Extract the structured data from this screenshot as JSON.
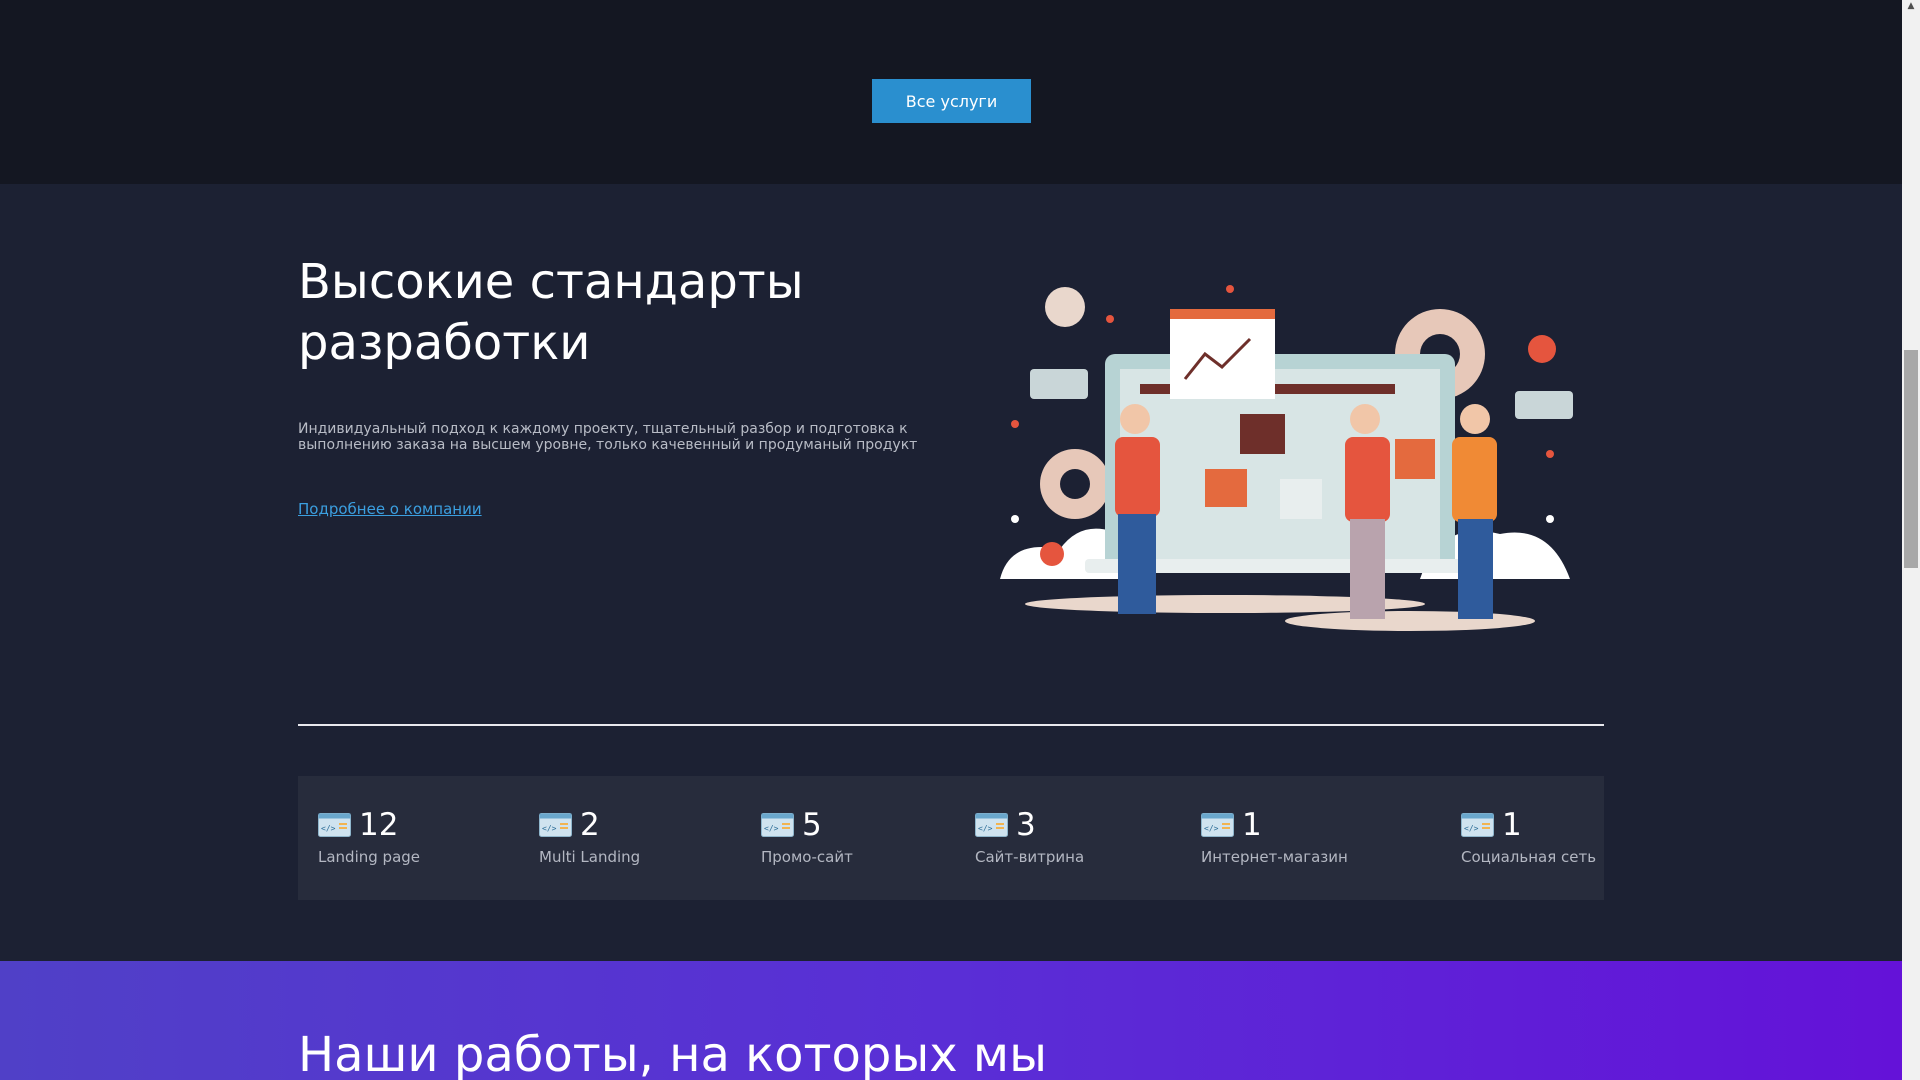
{
  "top": {
    "all_services_label": "Все услуги"
  },
  "standards": {
    "title_line1": "Высокие стандарты",
    "title_line2": "разработки",
    "description": "Индивидуальный подход к каждому проекту, тщательный разбор и подготовка к выполнению заказа на высшем уровне, только качевенный и продуманый продукт",
    "about_link": "Подробнее о компании"
  },
  "stats": [
    {
      "value": "12",
      "label": "Landing page",
      "icon": "code-window-icon"
    },
    {
      "value": "2",
      "label": "Multi Landing",
      "icon": "code-window-icon"
    },
    {
      "value": "5",
      "label": "Промо-сайт",
      "icon": "code-window-icon"
    },
    {
      "value": "3",
      "label": "Сайт-витрина",
      "icon": "code-window-icon"
    },
    {
      "value": "1",
      "label": "Интернет-магазин",
      "icon": "code-window-icon"
    },
    {
      "value": "1",
      "label": "Социальная сеть",
      "icon": "code-window-icon"
    }
  ],
  "works": {
    "title": "Наши работы, на которых мы"
  },
  "colors": {
    "accent_button": "#2a8fcf",
    "link": "#3b9fe0",
    "dark_bg": "#141722",
    "section_bg": "#1c2133",
    "stats_bg": "#272c3c",
    "gradient_start": "#5040c7",
    "gradient_end": "#6412d8"
  }
}
